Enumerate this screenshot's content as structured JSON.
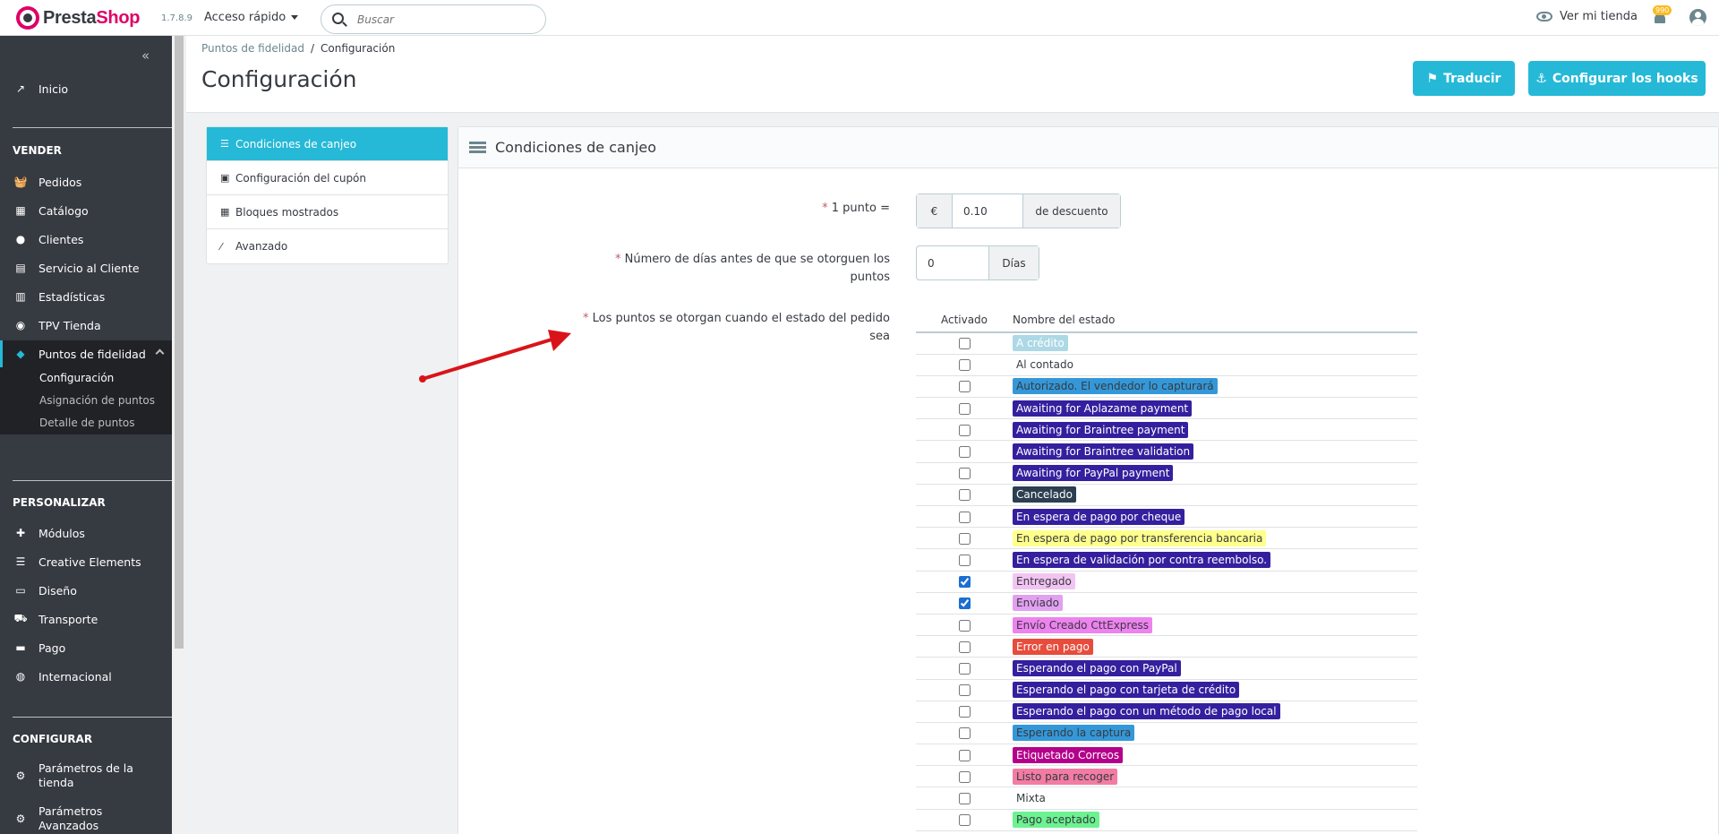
{
  "header": {
    "logo_text_a": "Presta",
    "logo_text_b": "Shop",
    "version": "1.7.8.9",
    "quick_access": "Acceso rápido",
    "search_placeholder": "Buscar",
    "view_shop": "Ver mi tienda",
    "notifications_count": "990"
  },
  "sidebar": {
    "home": "Inicio",
    "section_sell": "VENDER",
    "orders": "Pedidos",
    "catalog": "Catálogo",
    "customers": "Clientes",
    "customer_service": "Servicio al Cliente",
    "stats": "Estadísticas",
    "pos": "TPV Tienda",
    "loyalty": "Puntos de fidelidad",
    "sub_config": "Configuración",
    "sub_assign": "Asignación de puntos",
    "sub_detail": "Detalle de puntos",
    "section_customize": "PERSONALIZAR",
    "modules": "Módulos",
    "creative": "Creative Elements",
    "design": "Diseño",
    "shipping": "Transporte",
    "payment": "Pago",
    "international": "Internacional",
    "section_configure": "CONFIGURAR",
    "shop_params_1": "Parámetros de la",
    "shop_params_2": "tienda",
    "adv_params_1": "Parámetros",
    "adv_params_2": "Avanzados"
  },
  "page": {
    "breadcrumb_parent": "Puntos de fidelidad",
    "breadcrumb_sep": "/",
    "breadcrumb_current": "Configuración",
    "title": "Configuración",
    "btn_translate": "Traducir",
    "btn_hooks": "Configurar los hooks"
  },
  "tabs": [
    {
      "label": "Condiciones de canjeo",
      "icon": "list-icon",
      "active": true
    },
    {
      "label": "Configuración del cupón",
      "icon": "money-icon",
      "active": false
    },
    {
      "label": "Bloques mostrados",
      "icon": "grid-icon",
      "active": false
    },
    {
      "label": "Avanzado",
      "icon": "wand-icon",
      "active": false
    }
  ],
  "panel": {
    "heading": "Condiciones de canjeo",
    "req_mark": "*",
    "point_label": "1 punto =",
    "currency": "€",
    "point_value": "0.10",
    "discount_suffix": "de descuento",
    "days_label_1": "Número de días antes de que se otorguen los",
    "days_label_2": "puntos",
    "days_value": "0",
    "days_suffix": "Días",
    "states_label_1": "Los puntos se otorgan cuando el estado del pedido",
    "states_label_2": "sea",
    "col_active": "Activado",
    "col_name": "Nombre del estado"
  },
  "states": [
    {
      "name": "A crédito",
      "bg": "#add8e6",
      "fg": "#ffffff",
      "checked": false
    },
    {
      "name": "Al contado",
      "bg": "transparent",
      "fg": "#363a41",
      "checked": false
    },
    {
      "name": "Autorizado. El vendedor lo capturará",
      "bg": "#3498d8",
      "fg": "#363a41",
      "checked": false
    },
    {
      "name": "Awaiting for Aplazame payment",
      "bg": "#34209e",
      "fg": "#ffffff",
      "checked": false
    },
    {
      "name": "Awaiting for Braintree payment",
      "bg": "#34209e",
      "fg": "#ffffff",
      "checked": false
    },
    {
      "name": "Awaiting for Braintree validation",
      "bg": "#34209e",
      "fg": "#ffffff",
      "checked": false
    },
    {
      "name": "Awaiting for PayPal payment",
      "bg": "#34209e",
      "fg": "#ffffff",
      "checked": false
    },
    {
      "name": "Cancelado",
      "bg": "#2c3e50",
      "fg": "#ffffff",
      "checked": false
    },
    {
      "name": "En espera de pago por cheque",
      "bg": "#34209e",
      "fg": "#ffffff",
      "checked": false
    },
    {
      "name": "En espera de pago por transferencia bancaria",
      "bg": "#ffff8c",
      "fg": "#363a41",
      "checked": false
    },
    {
      "name": "En espera de validación por contra reembolso.",
      "bg": "#34209e",
      "fg": "#ffffff",
      "checked": false
    },
    {
      "name": "Entregado",
      "bg": "#f3c4f2",
      "fg": "#363a41",
      "checked": true
    },
    {
      "name": "Enviado",
      "bg": "#e2a0f0",
      "fg": "#363a41",
      "checked": true
    },
    {
      "name": "Envío Creado CttExpress",
      "bg": "#ee82ee",
      "fg": "#363a41",
      "checked": false
    },
    {
      "name": "Error en pago",
      "bg": "#e74c3c",
      "fg": "#ffffff",
      "checked": false
    },
    {
      "name": "Esperando el pago con PayPal",
      "bg": "#34209e",
      "fg": "#ffffff",
      "checked": false
    },
    {
      "name": "Esperando el pago con tarjeta de crédito",
      "bg": "#34209e",
      "fg": "#ffffff",
      "checked": false
    },
    {
      "name": "Esperando el pago con un método de pago local",
      "bg": "#34209e",
      "fg": "#ffffff",
      "checked": false
    },
    {
      "name": "Esperando la captura",
      "bg": "#3498d8",
      "fg": "#363a41",
      "checked": false
    },
    {
      "name": "Etiquetado Correos",
      "bg": "#b4008a",
      "fg": "#ffffff",
      "checked": false
    },
    {
      "name": "Listo para recoger",
      "bg": "#f27ca3",
      "fg": "#363a41",
      "checked": false
    },
    {
      "name": "Mixta",
      "bg": "transparent",
      "fg": "#363a41",
      "checked": false
    },
    {
      "name": "Pago aceptado",
      "bg": "#6cf290",
      "fg": "#363a41",
      "checked": false
    }
  ]
}
